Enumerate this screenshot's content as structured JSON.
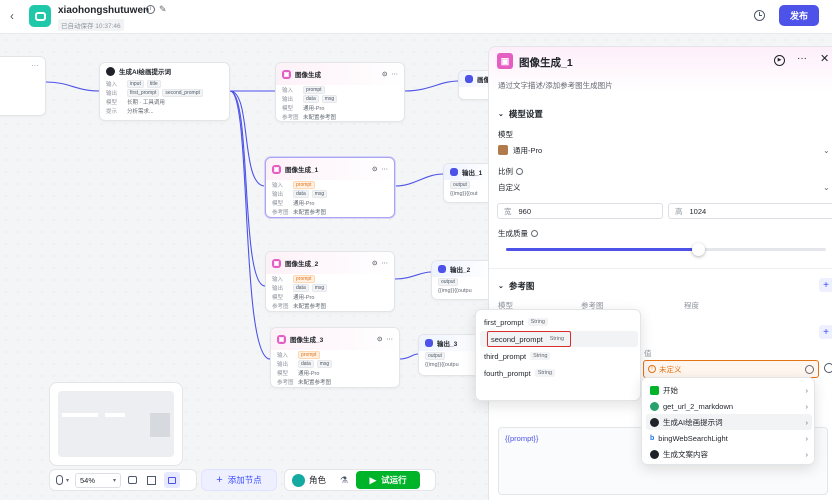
{
  "header": {
    "app_name": "xiaohongshutuwen",
    "save_status": "已自动保存 10:37:46",
    "publish_label": "发布"
  },
  "nodes": {
    "prompt_gen": {
      "title": "生成AI绘画提示词",
      "rows": [
        [
          "输入",
          "input",
          "title"
        ],
        [
          "输出",
          "first_prompt",
          "second_prompt"
        ],
        [
          "模型",
          "长期 · 工具调用",
          ""
        ],
        [
          "提示",
          "分析需求...",
          ""
        ]
      ]
    },
    "img_gen": {
      "title": "图像生成",
      "rows": [
        [
          "输入",
          "prompt",
          ""
        ],
        [
          "输出",
          "data",
          "msg"
        ],
        [
          "模型",
          "通用-Pro",
          ""
        ],
        [
          "参考图",
          "未配置参考图",
          ""
        ]
      ]
    },
    "img_gen_1": {
      "title": "图像生成_1",
      "rows": [
        [
          "输入",
          "prompt",
          ""
        ],
        [
          "输出",
          "data",
          "msg"
        ],
        [
          "模型",
          "通用-Pro",
          ""
        ],
        [
          "参考图",
          "未配置参考图",
          ""
        ]
      ]
    },
    "img_gen_2": {
      "title": "图像生成_2",
      "rows": [
        [
          "输入",
          "prompt",
          ""
        ],
        [
          "输出",
          "data",
          "msg"
        ],
        [
          "模型",
          "通用-Pro",
          ""
        ],
        [
          "参考图",
          "未配置参考图",
          ""
        ]
      ]
    },
    "img_gen_3": {
      "title": "图像生成_3",
      "rows": [
        [
          "输入",
          "prompt",
          ""
        ],
        [
          "输出",
          "data",
          "msg"
        ],
        [
          "模型",
          "通用-Pro",
          ""
        ],
        [
          "参考图",
          "未配置参考图",
          ""
        ]
      ]
    },
    "out_0": {
      "title": "画像"
    },
    "out_1": {
      "title": "输出_1",
      "r1": "output",
      "r2": "{{img}}{{out"
    },
    "out_2": {
      "title": "输出_2",
      "r1": "output",
      "r2": "{{img}}{{outpu"
    },
    "out_3": {
      "title": "输出_3",
      "r1": "output",
      "r2": "{{img}}{{outpu"
    }
  },
  "panel": {
    "title": "图像生成_1",
    "desc": "通过文字描述/添加参考图生成图片",
    "model_settings": "模型设置",
    "model_label": "模型",
    "model_value": "通用-Pro",
    "ratio_label": "比例",
    "ratio_value": "自定义",
    "width_prefix": "宽",
    "width_value": "960",
    "height_prefix": "高",
    "height_value": "1024",
    "quality_label": "生成质量",
    "quality_value": 0.6,
    "ref_title": "参考图",
    "ref_cols": [
      "模型",
      "参考图",
      "程度"
    ],
    "value_label": "值",
    "undefined_label": "未定义",
    "prompt_text": "{{prompt}}"
  },
  "var_menu": [
    {
      "name": "first_prompt",
      "type": "String"
    },
    {
      "name": "second_prompt",
      "type": "String"
    },
    {
      "name": "third_prompt",
      "type": "String"
    },
    {
      "name": "fourth_prompt",
      "type": "String"
    }
  ],
  "node_menu": [
    "开始",
    "get_url_2_markdown",
    "生成AI绘画提示词",
    "bingWebSearchLight",
    "生成文案内容"
  ],
  "toolbar": {
    "zoom": "54%",
    "add_node": "添加节点",
    "role": "角色",
    "run": "试运行"
  },
  "colors": {
    "accent": "#4d53e8",
    "pink": "#e45ec4",
    "green": "#00b42a",
    "orange": "#e37318",
    "red": "#d92d2d"
  }
}
